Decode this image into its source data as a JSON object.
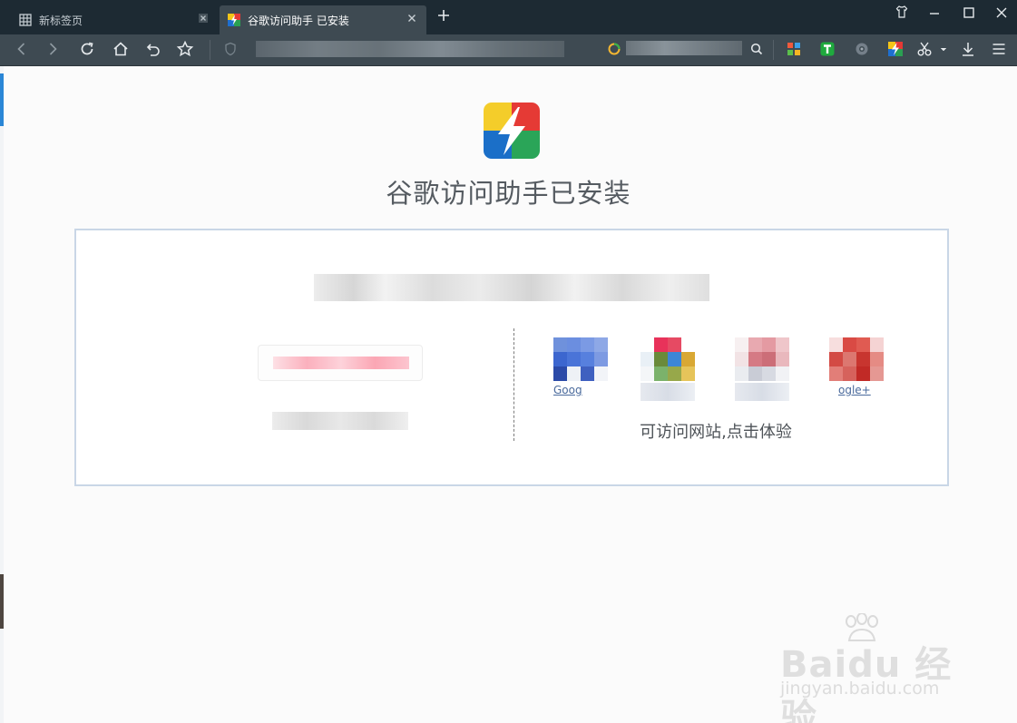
{
  "tabs": [
    {
      "label": "新标签页",
      "active": false
    },
    {
      "label": "谷歌访问助手 已安装",
      "active": true
    }
  ],
  "window_controls": [
    "skin-icon",
    "minimize-icon",
    "maximize-icon",
    "close-icon"
  ],
  "toolbar": {
    "nav_icons": [
      "back-icon",
      "forward-icon",
      "refresh-icon",
      "home-icon",
      "undo-icon",
      "star-icon"
    ],
    "extension_icons": [
      "apps-grid-icon",
      "t-extension-icon",
      "gear-extension-icon",
      "google-helper-extension-icon",
      "scissors-icon",
      "download-icon",
      "menu-icon"
    ]
  },
  "page": {
    "title": "谷歌访问助手已安装",
    "sites": [
      {
        "label": "Goog"
      },
      {
        "label": ""
      },
      {
        "label": ""
      },
      {
        "label": "ogle+"
      }
    ],
    "caption": "可访问网站,点击体验"
  },
  "watermark": {
    "brand": "Baidu 经验",
    "domain": "jingyan.baidu.com"
  },
  "colors": {
    "tabstrip_bg": "#1d2a33",
    "toolbar_bg": "#3e4a52",
    "card_border": "#c9d6e6",
    "link": "#4a6a9c"
  }
}
